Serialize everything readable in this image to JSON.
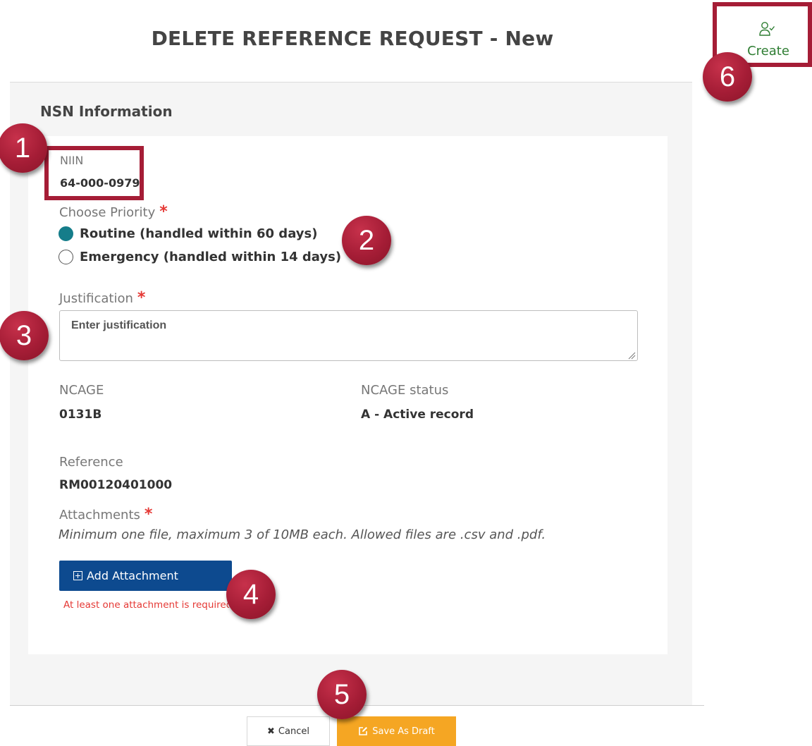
{
  "header": {
    "title": "DELETE REFERENCE REQUEST - New",
    "create_label": "Create"
  },
  "section": {
    "title": "NSN Information"
  },
  "niin": {
    "label": "NIIN",
    "value": "64-000-0979"
  },
  "priority": {
    "label": "Choose Priority",
    "required_mark": "*",
    "options": [
      {
        "label": "Routine (handled within 60 days)",
        "selected": true
      },
      {
        "label": "Emergency (handled within 14 days)",
        "selected": false
      }
    ]
  },
  "justification": {
    "label": "Justification",
    "required_mark": "*",
    "placeholder": "Enter justification"
  },
  "ncage": {
    "label": "NCAGE",
    "value": "0131B"
  },
  "ncage_status": {
    "label": "NCAGE status",
    "value": "A - Active record"
  },
  "reference": {
    "label": "Reference",
    "value": "RM00120401000"
  },
  "attachments": {
    "label": "Attachments",
    "required_mark": "*",
    "hint": "Minimum one file, maximum 3 of 10MB each. Allowed files are .csv and .pdf.",
    "add_button": "Add Attachment",
    "error": "At least one attachment is required"
  },
  "footer": {
    "cancel": "Cancel",
    "save_draft": "Save As Draft"
  },
  "callouts": [
    "1",
    "2",
    "3",
    "4",
    "5",
    "6"
  ],
  "colors": {
    "accent_teal": "#157d8a",
    "primary_blue": "#0d4a8f",
    "draft_orange": "#f5a623",
    "error_red": "#e53935",
    "create_green": "#2e7d32",
    "annotation_red": "#a51d36"
  },
  "icons": {
    "create": "user-check-icon",
    "add": "plus-square-icon",
    "cancel": "close-icon",
    "draft": "edit-icon"
  }
}
